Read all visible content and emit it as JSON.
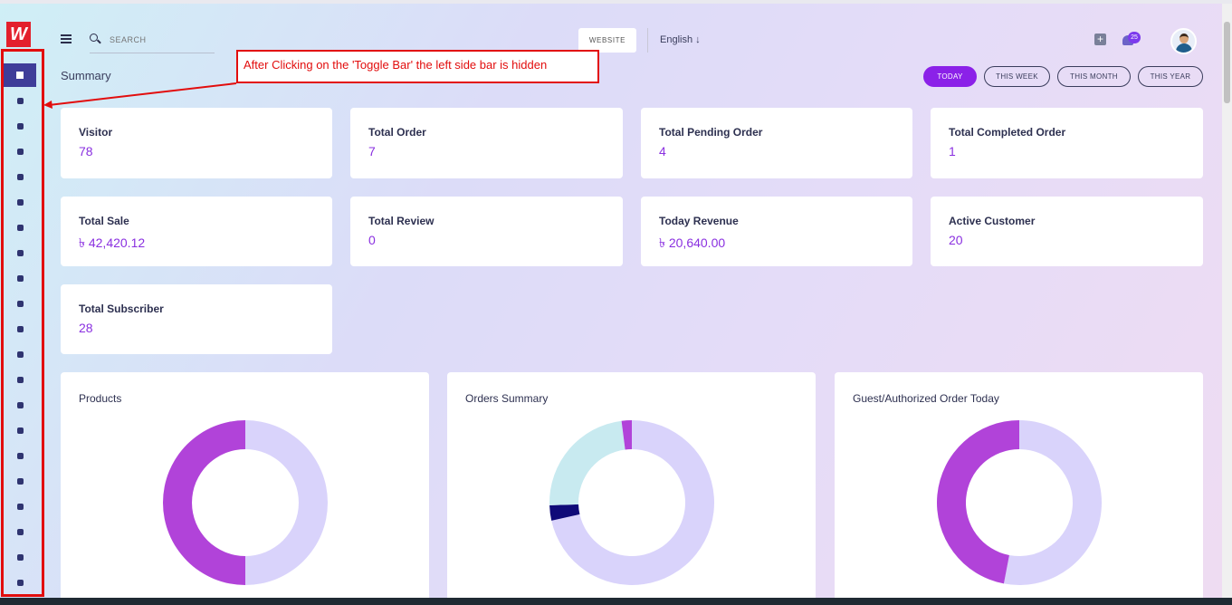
{
  "header": {
    "search_placeholder": "SEARCH",
    "website_label": "WEBSITE",
    "language": "English",
    "notification_count": "25"
  },
  "page_title": "Summary",
  "annotation": "After Clicking on the 'Toggle Bar' the left side bar is hidden",
  "period_buttons": [
    "TODAY",
    "THIS WEEK",
    "THIS MONTH",
    "THIS YEAR"
  ],
  "stats": [
    {
      "label": "Visitor",
      "value": "78"
    },
    {
      "label": "Total Order",
      "value": "7"
    },
    {
      "label": "Total Pending Order",
      "value": "4"
    },
    {
      "label": "Total Completed Order",
      "value": "1"
    },
    {
      "label": "Total Sale",
      "value": "৳ 42,420.12"
    },
    {
      "label": "Total Review",
      "value": "0"
    },
    {
      "label": "Today Revenue",
      "value": "৳ 20,640.00"
    },
    {
      "label": "Active Customer",
      "value": "20"
    },
    {
      "label": "Total Subscriber",
      "value": "28"
    }
  ],
  "sidebar": {
    "logo_text": "W",
    "icons": [
      "dashboard-icon",
      "user-icon",
      "user-icon",
      "ticket-icon",
      "cogs-icon",
      "cogs-icon",
      "users-icon",
      "users-icon",
      "folder-icon",
      "user-icon",
      "user-icon",
      "gift-icon",
      "question-icon",
      "user-icon",
      "cart-icon",
      "cart-icon",
      "gear-icon",
      "money-icon",
      "wrench-icon",
      "image-icon",
      "wrench-icon"
    ]
  },
  "colors": {
    "accent": "#8b21e8",
    "sidebar_active": "#3f3d99",
    "annotation_red": "#e20d0d",
    "chart_purple": "#b143d9",
    "chart_lavender": "#d9d3fb",
    "chart_teal": "#c8eaf0",
    "chart_navy": "#0f0a78"
  },
  "chart_data": [
    {
      "type": "pie",
      "title": "Products",
      "donut": true,
      "slices": [
        {
          "value": 50,
          "color": "#d9d3fb"
        },
        {
          "value": 50,
          "color": "#b143d9"
        }
      ]
    },
    {
      "type": "pie",
      "title": "Orders Summary",
      "donut": true,
      "slices": [
        {
          "value": 71.5,
          "color": "#d9d3fb"
        },
        {
          "value": 3,
          "color": "#0f0a78"
        },
        {
          "value": 23.5,
          "color": "#c8eaf0"
        },
        {
          "value": 2,
          "color": "#b143d9"
        }
      ]
    },
    {
      "type": "pie",
      "title": "Guest/Authorized Order Today",
      "donut": true,
      "slices": [
        {
          "value": 53,
          "color": "#d9d3fb"
        },
        {
          "value": 47,
          "color": "#b143d9"
        }
      ]
    }
  ]
}
